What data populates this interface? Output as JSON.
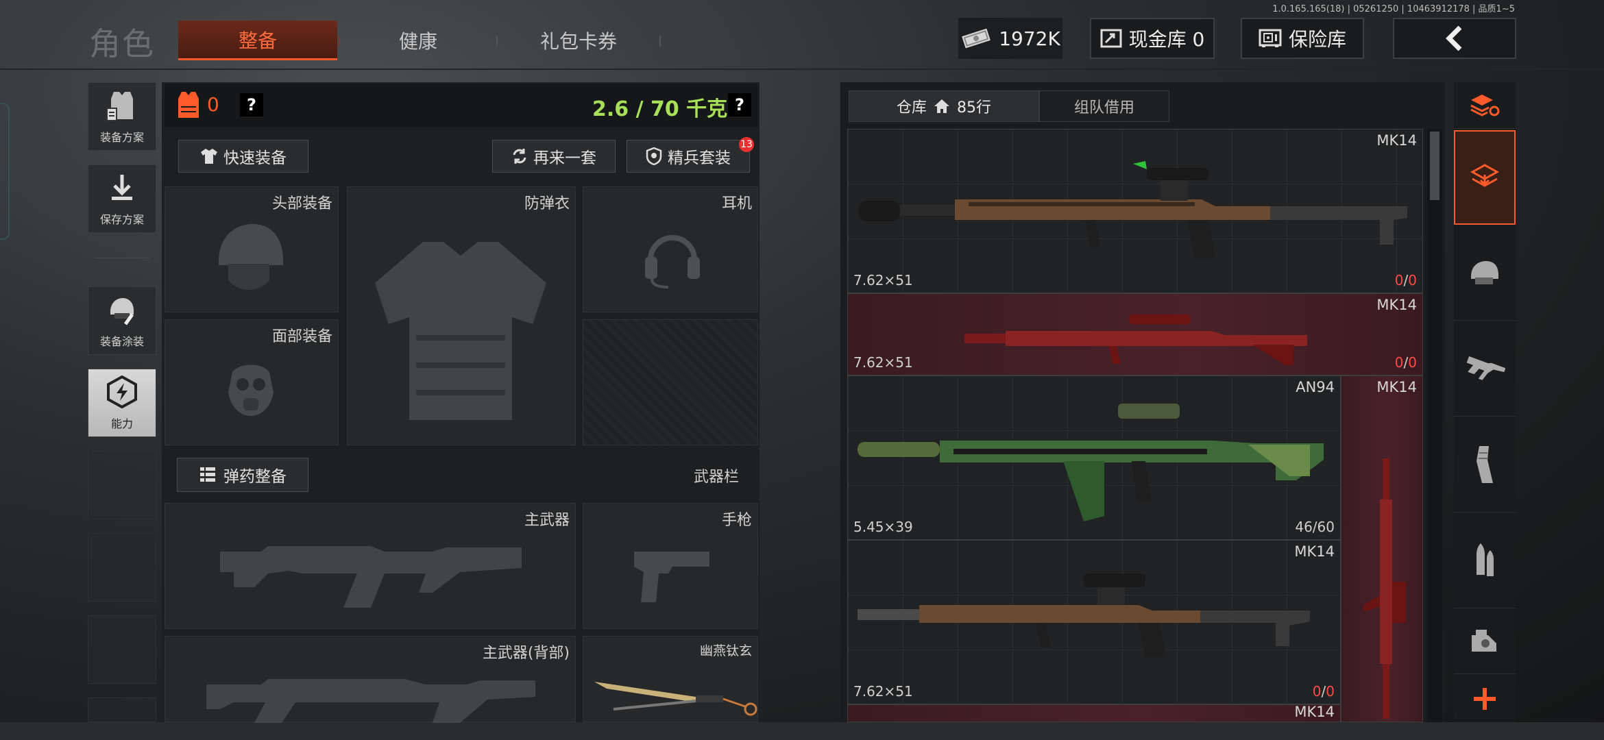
{
  "version": "1.0.165.165(18) | 05261250 | 10463912178 | 品质1~5",
  "header": {
    "title": "角色",
    "tabs": [
      {
        "label": "整备",
        "active": true
      },
      {
        "label": "健康"
      },
      {
        "label": "礼包卡券"
      }
    ],
    "money": "1972K",
    "cash_vault": "现金库 0",
    "vault": "保险库"
  },
  "sidebar": {
    "items": [
      {
        "label": "装备方案"
      },
      {
        "label": "保存方案"
      },
      {
        "label": "装备涂装"
      },
      {
        "label": "能力"
      }
    ]
  },
  "equip": {
    "armor_value": "0",
    "weight": "2.6 / 70 千克",
    "quick_equip": "快速装备",
    "again": "再来一套",
    "elite": "精兵套装",
    "elite_badge": "13",
    "slots": {
      "head": "头部装备",
      "vest": "防弹衣",
      "earphone": "耳机",
      "face": "面部装备"
    },
    "ammo_btn": "弹药整备",
    "weapon_bar": "武器栏",
    "primary": "主武器",
    "pistol": "手枪",
    "primary_back": "主武器(背部)",
    "melee": "幽燕钛玄"
  },
  "warehouse": {
    "tab_label": "仓库",
    "rows": "85行",
    "team_borrow": "组队借用",
    "items": [
      {
        "name": "MK14",
        "ammo": "7.62×51",
        "count_cur": "0",
        "count_max": "0"
      },
      {
        "name": "MK14",
        "ammo": "7.62×51",
        "count_cur": "0",
        "count_max": "0"
      },
      {
        "name": "AN94",
        "ammo": "5.45×39",
        "count": "46/60"
      },
      {
        "name": "MK14",
        "ammo": "7.62×51",
        "count_cur": "0",
        "count_max": "0"
      },
      {
        "name": "MK14"
      },
      {
        "name": "MK14"
      }
    ]
  },
  "colors": {
    "accent": "#ff5a2a",
    "weight_green": "#a8e05a",
    "red_item": "#4a2129",
    "alert": "#ff4a4a"
  },
  "categories": [
    "sort-icon",
    "all-items-icon",
    "helmet-icon",
    "rifle-icon",
    "magazine-icon",
    "ammo-icon",
    "scope-icon",
    "add-icon"
  ]
}
